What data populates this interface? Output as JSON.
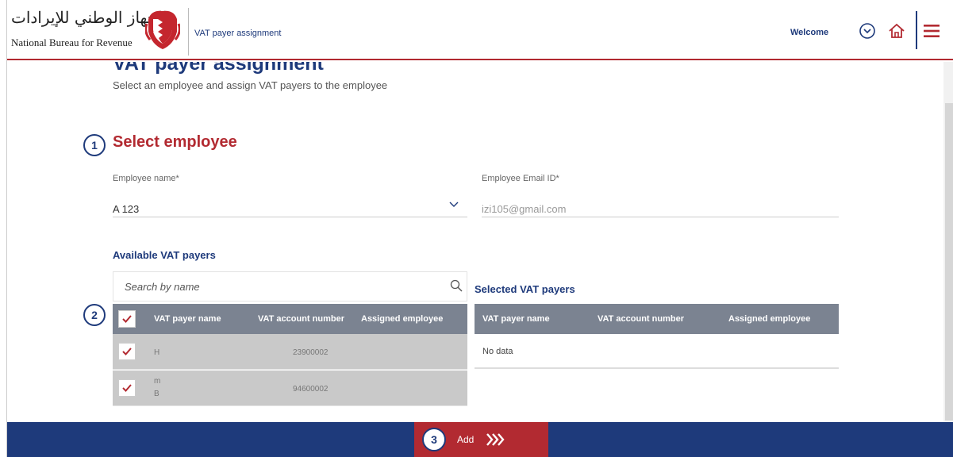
{
  "header": {
    "logo_arabic": "الجهاز الوطني للإيرادات",
    "logo_english": "National Bureau for Revenue",
    "page_name": "VAT payer assignment",
    "welcome": "Welcome"
  },
  "page": {
    "title": "VAT payer assignment",
    "subtitle": "Select an employee and assign VAT payers to the employee"
  },
  "steps": [
    "1",
    "2",
    "3"
  ],
  "employee": {
    "section_title": "Select employee",
    "name_label": "Employee name*",
    "name_value": "A 123",
    "email_label": "Employee Email ID*",
    "email_value": "izi105@gmail.com"
  },
  "available": {
    "title": "Available VAT payers",
    "search_placeholder": "Search by name",
    "columns": [
      "VAT payer name",
      "VAT account number",
      "Assigned employee"
    ],
    "rows": [
      {
        "name": "H",
        "name2": "",
        "account": "23900002",
        "employee": "",
        "checked": true
      },
      {
        "name": "m",
        "name2": "B",
        "account": "94600002",
        "employee": "",
        "checked": true
      }
    ]
  },
  "selected": {
    "title": "Selected VAT payers",
    "columns": [
      "VAT payer name",
      "VAT account number",
      "Assigned employee"
    ],
    "empty_text": "No data"
  },
  "footer": {
    "add_label": "Add"
  },
  "colors": {
    "brand_blue": "#1e3a7b",
    "brand_red": "#b22a31",
    "table_header": "#7b8391"
  },
  "icons": [
    "emblem-icon",
    "chevron-circle-icon",
    "home-icon",
    "hamburger-menu-icon",
    "chevron-down-icon",
    "search-icon",
    "checkmark-icon",
    "double-chevron-right-icon"
  ]
}
